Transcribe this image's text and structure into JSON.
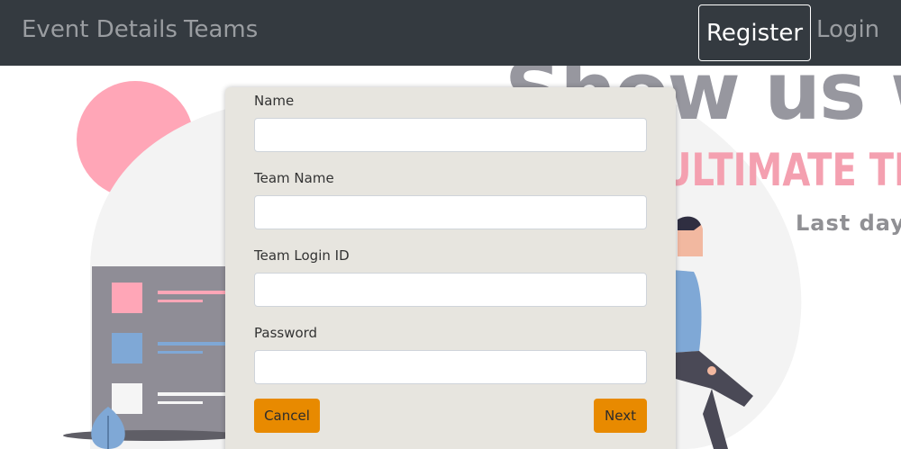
{
  "navbar": {
    "event_details": "Event Details",
    "teams": "Teams",
    "register": "Register",
    "login": "Login"
  },
  "hero": {
    "title": "Show us wha",
    "subtitle": "ULTIMATE TEC",
    "note": "Last day"
  },
  "form": {
    "fields": [
      {
        "label": "Name",
        "value": "",
        "placeholder": ""
      },
      {
        "label": "Team Name",
        "value": "",
        "placeholder": ""
      },
      {
        "label": "Team Login ID",
        "value": "",
        "placeholder": ""
      },
      {
        "label": "Password",
        "value": "",
        "placeholder": ""
      }
    ],
    "cancel_label": "Cancel",
    "next_label": "Next"
  },
  "colors": {
    "navbar_bg": "#343a40",
    "modal_bg": "#e7e5df",
    "button_bg": "#e88a00",
    "accent_pink": "#f4a0b0",
    "accent_blue": "#7fa8d6"
  }
}
